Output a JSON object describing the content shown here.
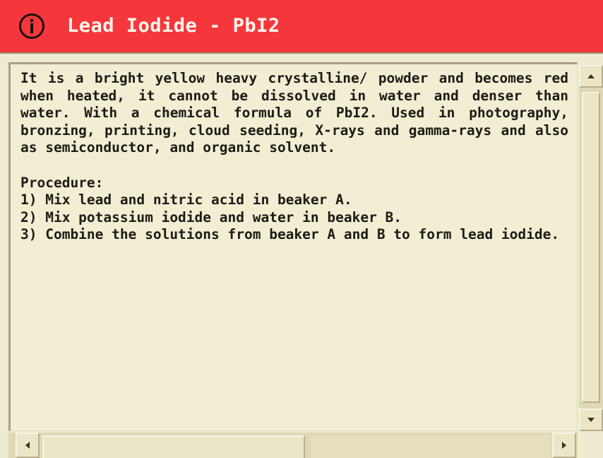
{
  "window": {
    "title": "Lead Iodide - PbI2",
    "title_icon": "info-circle-icon",
    "titlebar_color": "#f5373c",
    "background_color": "#f1eed3",
    "text_color": "#1e1a14"
  },
  "content": {
    "description": "It is a bright yellow heavy crystalline/ powder and becomes red when heated, it cannot be dissolved in water and denser than water. With a chemical formula of PbI2. Used in photography, bronzing, printing, cloud seeding, X-rays and gamma-rays and also as semiconductor, and organic solvent.",
    "procedure_heading": "Procedure:",
    "steps": [
      "1) Mix lead and nitric acid in beaker A.",
      "2) Mix potassium iodide and water in beaker B.",
      "3) Combine the solutions from beaker A and B to form lead iodide."
    ]
  },
  "scrollbars": {
    "vertical": {
      "up_icon": "arrow-up-icon",
      "down_icon": "arrow-down-icon"
    },
    "horizontal": {
      "left_icon": "arrow-left-icon",
      "right_icon": "arrow-right-icon"
    }
  }
}
